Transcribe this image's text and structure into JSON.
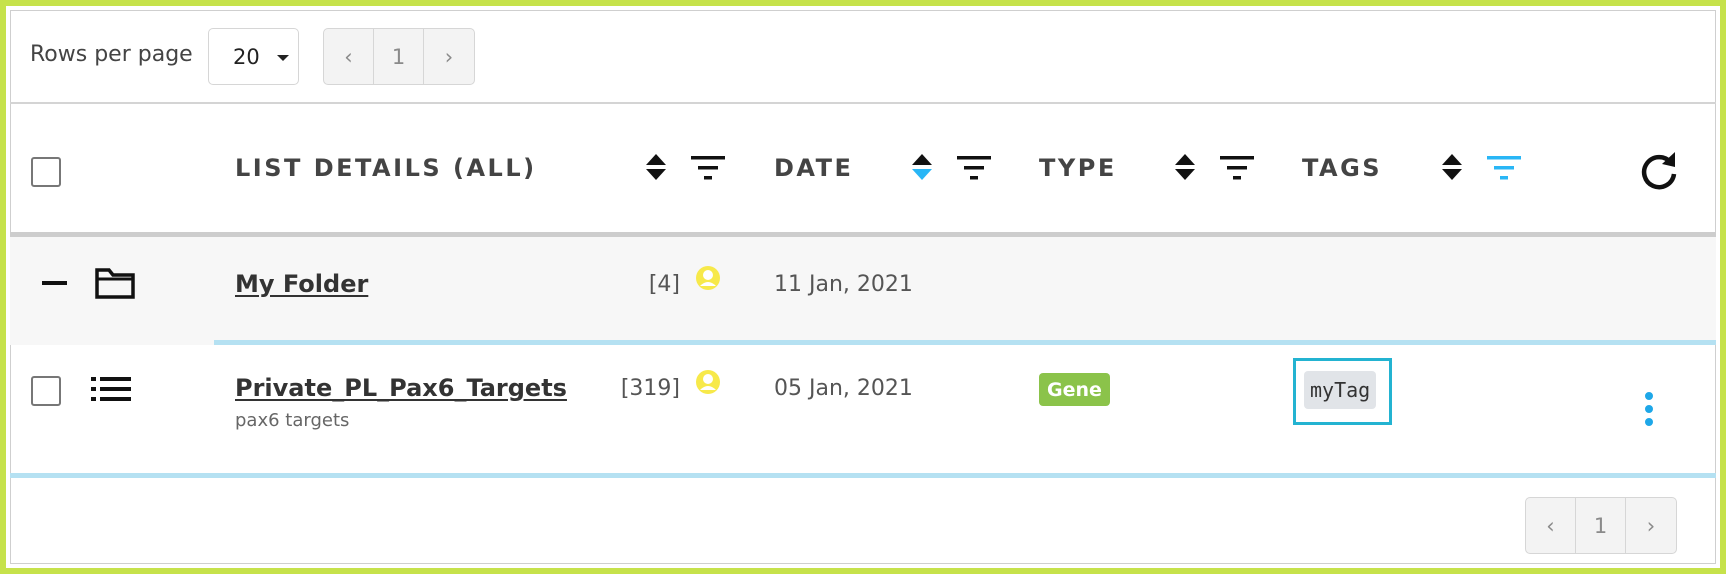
{
  "pagination": {
    "rows_label": "Rows per page",
    "rows_value": "20",
    "prev": "‹",
    "page": "1",
    "next": "›"
  },
  "header": {
    "col_list_details": "LIST DETAILS (ALL)",
    "col_date": "DATE",
    "col_type": "TYPE",
    "col_tags": "TAGS",
    "active_color": "#29b6f6"
  },
  "rows": [
    {
      "kind": "folder",
      "name": "My Folder",
      "count": "[4]",
      "date": "11 Jan, 2021"
    },
    {
      "kind": "list",
      "name": "Private_PL_Pax6_Targets",
      "subtitle": "pax6 targets",
      "count": "[319]",
      "date": "05 Jan, 2021",
      "type": "Gene",
      "tag": "myTag"
    }
  ],
  "colors": {
    "frame": "#c6e24b",
    "gene_badge": "#8bc34a",
    "tag_highlight": "#23b3d1",
    "owner_icon": "#f7e94a",
    "row_divider": "#b5e1f2"
  }
}
